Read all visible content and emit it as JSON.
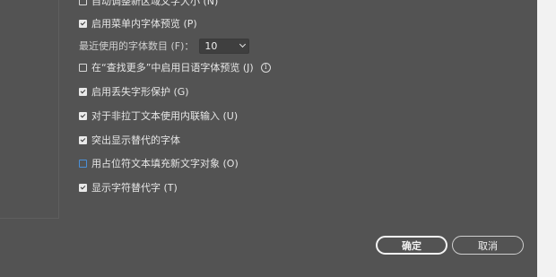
{
  "options": [
    {
      "label": "自动调整新区域文字大小 (N)",
      "checked": false,
      "style": "normal"
    },
    {
      "label": "启用菜单内字体预览 (P)",
      "checked": true,
      "style": "normal"
    },
    {
      "label": "在“查找更多”中启用日语字体预览 (J)",
      "checked": false,
      "style": "normal",
      "info": true
    },
    {
      "label": "启用丢失字形保护 (G)",
      "checked": true,
      "style": "normal"
    },
    {
      "label": "对于非拉丁文本使用内联输入 (U)",
      "checked": true,
      "style": "normal"
    },
    {
      "label": "突出显示替代的字体",
      "checked": true,
      "style": "normal"
    },
    {
      "label": "用占位符文本填充新文字对象 (O)",
      "checked": false,
      "style": "blue"
    },
    {
      "label": "显示字符替代字 (T)",
      "checked": true,
      "style": "normal"
    }
  ],
  "recent_fonts": {
    "label": "最近使用的字体数目 (F)：",
    "value": "10"
  },
  "buttons": {
    "ok": "确定",
    "cancel": "取消"
  },
  "icons": {
    "info": "info-icon",
    "dropdown": "chevron-down-icon"
  }
}
